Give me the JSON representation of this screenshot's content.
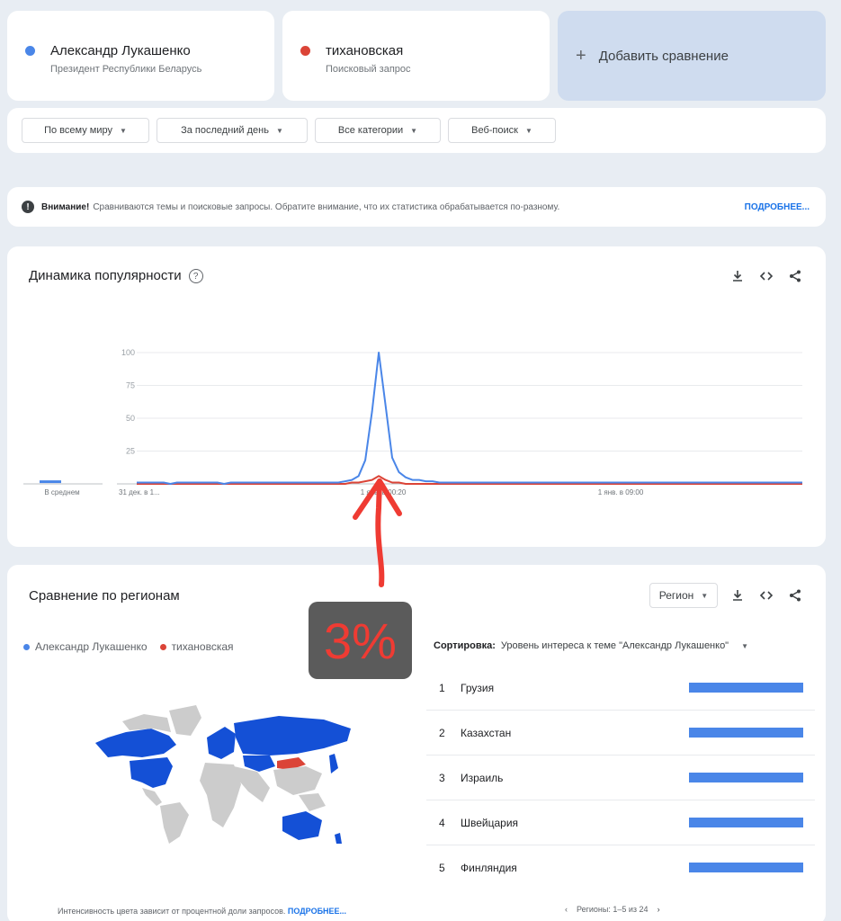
{
  "terms": [
    {
      "name": "Александр Лукашенко",
      "subtitle": "Президент Республики Беларусь",
      "color": "#4a86e8"
    },
    {
      "name": "тихановская",
      "subtitle": "Поисковый запрос",
      "color": "#db4437"
    }
  ],
  "add_compare": {
    "plus": "+",
    "label": "Добавить сравнение"
  },
  "filters": [
    {
      "label": "По всему миру"
    },
    {
      "label": "За последний день"
    },
    {
      "label": "Все категории"
    },
    {
      "label": "Веб-поиск"
    }
  ],
  "notice": {
    "icon": "!",
    "bold": "Внимание!",
    "text": "Сравниваются темы и поисковые запросы. Обратите внимание, что их статистика обрабатывается по-разному.",
    "more": "ПОДРОБНЕЕ..."
  },
  "trend": {
    "title": "Динамика популярности",
    "help_icon": "?"
  },
  "chart_data": {
    "type": "line",
    "y_ticks": [
      "100",
      "75",
      "50",
      "25"
    ],
    "ylim": [
      0,
      100
    ],
    "x_labels": [
      "31 дек. в 1...",
      "1 янв. в 00:20",
      "1 янв. в 09:00"
    ],
    "average_label": "В среднем",
    "averages": [
      2,
      0
    ],
    "series": [
      {
        "name": "Александр Лукашенко",
        "color": "#4a86e8",
        "values": [
          1,
          1,
          1,
          1,
          1,
          0,
          1,
          1,
          1,
          1,
          1,
          1,
          1,
          0,
          1,
          1,
          1,
          1,
          1,
          1,
          1,
          1,
          1,
          1,
          1,
          1,
          1,
          1,
          1,
          1,
          1,
          2,
          3,
          6,
          18,
          55,
          100,
          60,
          20,
          9,
          5,
          3,
          3,
          2,
          2,
          1,
          1,
          1,
          1,
          1,
          1,
          1,
          1,
          1,
          1,
          1,
          1,
          1,
          1,
          1,
          1,
          1,
          1,
          1,
          1,
          1,
          1,
          1,
          1,
          1,
          1,
          1,
          1,
          1,
          1,
          1,
          1,
          1,
          1,
          1,
          1,
          1,
          1,
          1,
          1,
          1,
          1,
          1,
          1,
          1,
          1,
          1,
          1,
          1,
          1,
          1,
          1,
          1,
          1,
          1
        ]
      },
      {
        "name": "тихановская",
        "color": "#db4437",
        "values": [
          0,
          0,
          0,
          0,
          0,
          0,
          0,
          0,
          0,
          0,
          0,
          0,
          0,
          0,
          0,
          0,
          0,
          0,
          0,
          0,
          0,
          0,
          0,
          0,
          0,
          0,
          0,
          0,
          0,
          0,
          0,
          0,
          1,
          1,
          2,
          3,
          6,
          3,
          1,
          1,
          0,
          0,
          0,
          0,
          0,
          0,
          0,
          0,
          0,
          0,
          0,
          0,
          0,
          0,
          0,
          0,
          0,
          0,
          0,
          0,
          0,
          0,
          0,
          0,
          0,
          0,
          0,
          0,
          0,
          0,
          0,
          0,
          0,
          0,
          0,
          0,
          0,
          0,
          0,
          0,
          0,
          0,
          0,
          0,
          0,
          0,
          0,
          0,
          0,
          0,
          0,
          0,
          0,
          0,
          0,
          0,
          0,
          0,
          0,
          0
        ]
      }
    ]
  },
  "annotation": {
    "text": "3%",
    "color": "#ef3b33"
  },
  "regions": {
    "title": "Сравнение по регионам",
    "select_label": "Регион",
    "legend": [
      "Александр Лукашенко",
      "тихановская"
    ],
    "sort_label": "Сортировка:",
    "sort_value": "Уровень интереса к теме \"Александр Лукашенко\"",
    "rows": [
      {
        "rank": "1",
        "name": "Грузия",
        "value": 100
      },
      {
        "rank": "2",
        "name": "Казахстан",
        "value": 100
      },
      {
        "rank": "3",
        "name": "Израиль",
        "value": 100
      },
      {
        "rank": "4",
        "name": "Швейцария",
        "value": 100
      },
      {
        "rank": "5",
        "name": "Финляндия",
        "value": 100
      }
    ],
    "footer_text": "Интенсивность цвета зависит от процентной доли запросов.",
    "footer_more": "ПОДРОБНЕЕ...",
    "pager": "Регионы: 1–5 из 24"
  },
  "icons": {
    "download": "download-icon",
    "embed": "embed-icon",
    "share": "share-icon"
  },
  "colors": {
    "background": "#e8edf3",
    "accent": "#1a73e8",
    "blue": "#4a86e8",
    "red": "#db4437",
    "map_blue": "#1450d6",
    "map_grey": "#cccccc"
  }
}
